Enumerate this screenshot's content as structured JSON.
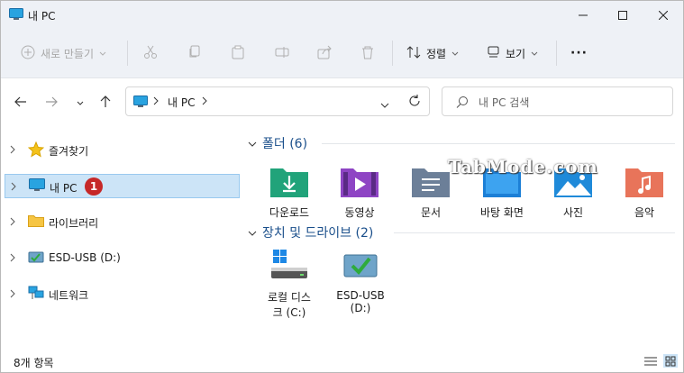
{
  "window": {
    "title": "내 PC"
  },
  "toolbar": {
    "new_label": "새로 만들기",
    "sort_label": "정렬",
    "view_label": "보기",
    "more_label": "···"
  },
  "nav": {
    "breadcrumb": [
      "내 PC"
    ],
    "search_placeholder": "내 PC 검색"
  },
  "sidebar": {
    "items": [
      {
        "label": "즐겨찾기",
        "icon": "star-icon"
      },
      {
        "label": "내 PC",
        "icon": "pc-icon",
        "selected": true,
        "badge": "1"
      },
      {
        "label": "라이브러리",
        "icon": "library-folder-icon"
      },
      {
        "label": "ESD-USB (D:)",
        "icon": "usb-drive-icon"
      },
      {
        "label": "네트워크",
        "icon": "network-icon"
      }
    ]
  },
  "main": {
    "folders_header": "폴더 (6)",
    "folders": [
      {
        "label": "다운로드",
        "icon": "downloads-folder-icon"
      },
      {
        "label": "동영상",
        "icon": "videos-folder-icon"
      },
      {
        "label": "문서",
        "icon": "documents-folder-icon"
      },
      {
        "label": "바탕 화면",
        "icon": "desktop-folder-icon"
      },
      {
        "label": "사진",
        "icon": "pictures-folder-icon"
      },
      {
        "label": "음악",
        "icon": "music-folder-icon"
      }
    ],
    "drives_header": "장치 및 드라이브 (2)",
    "drives": [
      {
        "label_line1": "로컬 디스",
        "label_line2": "크 (C:)",
        "icon": "local-disk-icon"
      },
      {
        "label_line1": "ESD-USB",
        "label_line2": "(D:)",
        "icon": "usb-drive-icon"
      }
    ],
    "watermark": "TabMode.com"
  },
  "status": {
    "item_count": "8개 항목"
  },
  "colors": {
    "accent": "#0067c0",
    "selection": "#cce4f7",
    "badge": "#c62828"
  }
}
